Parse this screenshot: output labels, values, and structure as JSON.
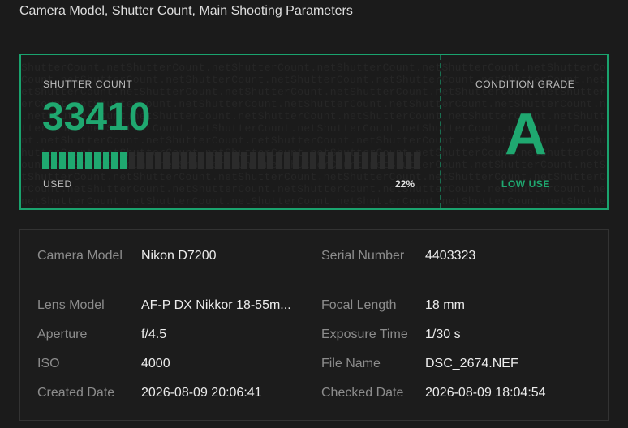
{
  "header": {
    "title": "Camera Model, Shutter Count, Main Shooting Parameters"
  },
  "shutter": {
    "label": "SHUTTER COUNT",
    "count": "33410",
    "used_label": "USED",
    "used_percent": "22%",
    "used_fraction": 0.22,
    "watermark_text": "ShutterCount.net"
  },
  "condition": {
    "label": "CONDITION GRADE",
    "grade": "A",
    "status": "LOW USE"
  },
  "details": {
    "camera_model": {
      "label": "Camera Model",
      "value": "Nikon D7200"
    },
    "serial_number": {
      "label": "Serial Number",
      "value": "4403323"
    },
    "lens_model": {
      "label": "Lens Model",
      "value": "AF-P DX Nikkor 18-55m..."
    },
    "focal_length": {
      "label": "Focal Length",
      "value": "18 mm"
    },
    "aperture": {
      "label": "Aperture",
      "value": "f/4.5"
    },
    "exposure_time": {
      "label": "Exposure Time",
      "value": "1/30 s"
    },
    "iso": {
      "label": "ISO",
      "value": "4000"
    },
    "file_name": {
      "label": "File Name",
      "value": "DSC_2674.NEF"
    },
    "created_date": {
      "label": "Created Date",
      "value": "2026-08-09 20:06:41"
    },
    "checked_date": {
      "label": "Checked Date",
      "value": "2026-08-09 18:04:54"
    }
  },
  "colors": {
    "accent": "#1fa870",
    "border": "#1aa36e"
  }
}
